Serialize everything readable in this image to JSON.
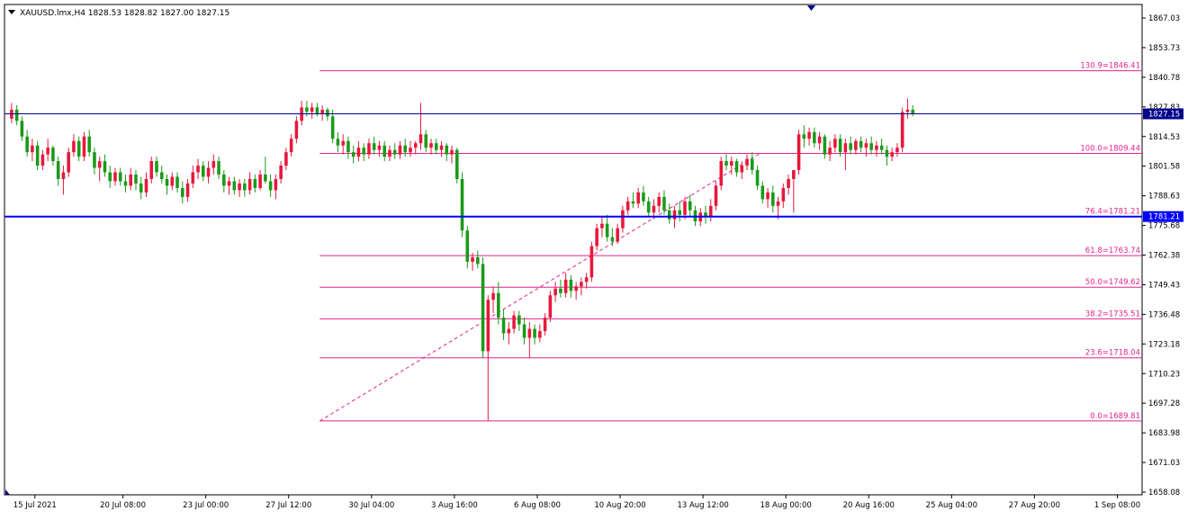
{
  "chart_data": {
    "type": "candlestick",
    "header": {
      "symbol": "XAUUSD.lmx,H4",
      "ohlc": "1828.53 1828.82 1827.00 1827.15"
    },
    "y_range": [
      1658.0,
      1870.0
    ],
    "x_slots": 216,
    "y_ticks": [
      "1867.03",
      "1853.73",
      "1840.78",
      "1827.83",
      "1814.53",
      "1801.58",
      "1788.63",
      "1775.68",
      "1762.38",
      "1749.43",
      "1736.48",
      "1723.18",
      "1710.23",
      "1697.28",
      "1683.98",
      "1671.03",
      "1658.08"
    ],
    "x_ticks": [
      {
        "label": "15 Jul 2021",
        "slot": 5
      },
      {
        "label": "20 Jul 08:00",
        "slot": 22
      },
      {
        "label": "23 Jul 00:00",
        "slot": 38
      },
      {
        "label": "27 Jul 12:00",
        "slot": 54
      },
      {
        "label": "30 Jul 04:00",
        "slot": 70
      },
      {
        "label": "3 Aug 16:00",
        "slot": 86
      },
      {
        "label": "6 Aug 08:00",
        "slot": 102
      },
      {
        "label": "10 Aug 20:00",
        "slot": 118
      },
      {
        "label": "13 Aug 12:00",
        "slot": 134
      },
      {
        "label": "18 Aug 00:00",
        "slot": 150
      },
      {
        "label": "20 Aug 16:00",
        "slot": 166
      },
      {
        "label": "25 Aug 04:00",
        "slot": 182
      },
      {
        "label": "27 Aug 20:00",
        "slot": 198
      },
      {
        "label": "1 Sep 08:00",
        "slot": 214
      }
    ],
    "price_lines": [
      {
        "value": 1827.15,
        "label": "1827.15",
        "color": "#00008b",
        "thick": false
      },
      {
        "value": 1781.21,
        "label": "1781.21",
        "color": "#0000ff",
        "thick": true
      }
    ],
    "fibonacci": {
      "color": "#e0258c",
      "start_slot": 60,
      "trend_start": {
        "slot": 60,
        "price": 1689.81
      },
      "trend_end": {
        "slot": 145,
        "price": 1809.44
      },
      "levels": [
        {
          "label": "130.9=1846.41",
          "value": 1846.41
        },
        {
          "label": "100.0=1809.44",
          "value": 1809.44
        },
        {
          "label": "76.4=1781.21",
          "value": 1781.21
        },
        {
          "label": "61.8=1763.74",
          "value": 1763.74
        },
        {
          "label": "50.0=1749.62",
          "value": 1749.62
        },
        {
          "label": "38.2=1735.51",
          "value": 1735.51
        },
        {
          "label": "23.6=1718.04",
          "value": 1718.04
        },
        {
          "label": "0.0=1689.81",
          "value": 1689.81
        }
      ]
    },
    "bull_color": "#e8173c",
    "bear_color": "#1a9a1a",
    "candles": [
      {
        "o": 1825,
        "h": 1832,
        "l": 1823,
        "c": 1829
      },
      {
        "o": 1829,
        "h": 1831,
        "l": 1822,
        "c": 1824
      },
      {
        "o": 1824,
        "h": 1826,
        "l": 1815,
        "c": 1817
      },
      {
        "o": 1817,
        "h": 1820,
        "l": 1808,
        "c": 1810
      },
      {
        "o": 1810,
        "h": 1816,
        "l": 1806,
        "c": 1813
      },
      {
        "o": 1813,
        "h": 1815,
        "l": 1802,
        "c": 1804
      },
      {
        "o": 1804,
        "h": 1811,
        "l": 1802,
        "c": 1809
      },
      {
        "o": 1809,
        "h": 1816,
        "l": 1806,
        "c": 1812
      },
      {
        "o": 1812,
        "h": 1813,
        "l": 1804,
        "c": 1806
      },
      {
        "o": 1806,
        "h": 1808,
        "l": 1795,
        "c": 1798
      },
      {
        "o": 1798,
        "h": 1804,
        "l": 1791,
        "c": 1801
      },
      {
        "o": 1801,
        "h": 1812,
        "l": 1799,
        "c": 1810
      },
      {
        "o": 1810,
        "h": 1818,
        "l": 1808,
        "c": 1815
      },
      {
        "o": 1815,
        "h": 1817,
        "l": 1806,
        "c": 1808
      },
      {
        "o": 1808,
        "h": 1819,
        "l": 1806,
        "c": 1817
      },
      {
        "o": 1817,
        "h": 1820,
        "l": 1808,
        "c": 1810
      },
      {
        "o": 1810,
        "h": 1812,
        "l": 1800,
        "c": 1803
      },
      {
        "o": 1803,
        "h": 1808,
        "l": 1797,
        "c": 1806
      },
      {
        "o": 1806,
        "h": 1809,
        "l": 1799,
        "c": 1801
      },
      {
        "o": 1801,
        "h": 1804,
        "l": 1794,
        "c": 1797
      },
      {
        "o": 1797,
        "h": 1803,
        "l": 1795,
        "c": 1801
      },
      {
        "o": 1801,
        "h": 1803,
        "l": 1795,
        "c": 1797
      },
      {
        "o": 1797,
        "h": 1800,
        "l": 1792,
        "c": 1795
      },
      {
        "o": 1795,
        "h": 1803,
        "l": 1793,
        "c": 1800
      },
      {
        "o": 1800,
        "h": 1802,
        "l": 1793,
        "c": 1796
      },
      {
        "o": 1796,
        "h": 1799,
        "l": 1789,
        "c": 1792
      },
      {
        "o": 1792,
        "h": 1801,
        "l": 1790,
        "c": 1798
      },
      {
        "o": 1798,
        "h": 1808,
        "l": 1796,
        "c": 1806
      },
      {
        "o": 1806,
        "h": 1808,
        "l": 1799,
        "c": 1801
      },
      {
        "o": 1801,
        "h": 1804,
        "l": 1796,
        "c": 1798
      },
      {
        "o": 1798,
        "h": 1800,
        "l": 1791,
        "c": 1795
      },
      {
        "o": 1795,
        "h": 1801,
        "l": 1793,
        "c": 1799
      },
      {
        "o": 1799,
        "h": 1801,
        "l": 1792,
        "c": 1794
      },
      {
        "o": 1794,
        "h": 1797,
        "l": 1787,
        "c": 1790
      },
      {
        "o": 1790,
        "h": 1798,
        "l": 1788,
        "c": 1796
      },
      {
        "o": 1796,
        "h": 1804,
        "l": 1794,
        "c": 1801
      },
      {
        "o": 1801,
        "h": 1807,
        "l": 1798,
        "c": 1804
      },
      {
        "o": 1804,
        "h": 1806,
        "l": 1797,
        "c": 1799
      },
      {
        "o": 1799,
        "h": 1806,
        "l": 1796,
        "c": 1803
      },
      {
        "o": 1803,
        "h": 1809,
        "l": 1800,
        "c": 1806
      },
      {
        "o": 1806,
        "h": 1808,
        "l": 1798,
        "c": 1800
      },
      {
        "o": 1800,
        "h": 1802,
        "l": 1792,
        "c": 1795
      },
      {
        "o": 1795,
        "h": 1799,
        "l": 1791,
        "c": 1797
      },
      {
        "o": 1797,
        "h": 1799,
        "l": 1791,
        "c": 1793
      },
      {
        "o": 1793,
        "h": 1798,
        "l": 1790,
        "c": 1796
      },
      {
        "o": 1796,
        "h": 1798,
        "l": 1790,
        "c": 1793
      },
      {
        "o": 1793,
        "h": 1801,
        "l": 1791,
        "c": 1798
      },
      {
        "o": 1798,
        "h": 1800,
        "l": 1792,
        "c": 1794
      },
      {
        "o": 1794,
        "h": 1802,
        "l": 1793,
        "c": 1800
      },
      {
        "o": 1800,
        "h": 1808,
        "l": 1796,
        "c": 1797
      },
      {
        "o": 1797,
        "h": 1800,
        "l": 1790,
        "c": 1793
      },
      {
        "o": 1793,
        "h": 1800,
        "l": 1789,
        "c": 1798
      },
      {
        "o": 1798,
        "h": 1806,
        "l": 1796,
        "c": 1804
      },
      {
        "o": 1804,
        "h": 1812,
        "l": 1802,
        "c": 1810
      },
      {
        "o": 1810,
        "h": 1818,
        "l": 1808,
        "c": 1816
      },
      {
        "o": 1816,
        "h": 1826,
        "l": 1814,
        "c": 1824
      },
      {
        "o": 1824,
        "h": 1833,
        "l": 1822,
        "c": 1830
      },
      {
        "o": 1830,
        "h": 1833,
        "l": 1826,
        "c": 1828
      },
      {
        "o": 1828,
        "h": 1832,
        "l": 1825,
        "c": 1830
      },
      {
        "o": 1830,
        "h": 1832,
        "l": 1826,
        "c": 1827
      },
      {
        "o": 1827,
        "h": 1831,
        "l": 1824,
        "c": 1829
      },
      {
        "o": 1829,
        "h": 1830,
        "l": 1824,
        "c": 1826
      },
      {
        "o": 1826,
        "h": 1829,
        "l": 1814,
        "c": 1816
      },
      {
        "o": 1816,
        "h": 1819,
        "l": 1810,
        "c": 1813
      },
      {
        "o": 1813,
        "h": 1818,
        "l": 1809,
        "c": 1815
      },
      {
        "o": 1815,
        "h": 1817,
        "l": 1807,
        "c": 1810
      },
      {
        "o": 1810,
        "h": 1813,
        "l": 1805,
        "c": 1808
      },
      {
        "o": 1808,
        "h": 1815,
        "l": 1806,
        "c": 1812
      },
      {
        "o": 1812,
        "h": 1814,
        "l": 1806,
        "c": 1809
      },
      {
        "o": 1809,
        "h": 1816,
        "l": 1807,
        "c": 1814
      },
      {
        "o": 1814,
        "h": 1817,
        "l": 1809,
        "c": 1811
      },
      {
        "o": 1811,
        "h": 1815,
        "l": 1808,
        "c": 1813
      },
      {
        "o": 1813,
        "h": 1815,
        "l": 1806,
        "c": 1808
      },
      {
        "o": 1808,
        "h": 1813,
        "l": 1806,
        "c": 1811
      },
      {
        "o": 1811,
        "h": 1814,
        "l": 1807,
        "c": 1809
      },
      {
        "o": 1809,
        "h": 1815,
        "l": 1807,
        "c": 1813
      },
      {
        "o": 1813,
        "h": 1816,
        "l": 1808,
        "c": 1810
      },
      {
        "o": 1810,
        "h": 1815,
        "l": 1808,
        "c": 1812
      },
      {
        "o": 1812,
        "h": 1815,
        "l": 1809,
        "c": 1814
      },
      {
        "o": 1814,
        "h": 1832,
        "l": 1811,
        "c": 1818
      },
      {
        "o": 1818,
        "h": 1820,
        "l": 1810,
        "c": 1812
      },
      {
        "o": 1812,
        "h": 1816,
        "l": 1809,
        "c": 1814
      },
      {
        "o": 1814,
        "h": 1816,
        "l": 1809,
        "c": 1811
      },
      {
        "o": 1811,
        "h": 1815,
        "l": 1808,
        "c": 1813
      },
      {
        "o": 1813,
        "h": 1814,
        "l": 1806,
        "c": 1809
      },
      {
        "o": 1809,
        "h": 1813,
        "l": 1805,
        "c": 1811
      },
      {
        "o": 1811,
        "h": 1812,
        "l": 1796,
        "c": 1798
      },
      {
        "o": 1798,
        "h": 1801,
        "l": 1772,
        "c": 1775
      },
      {
        "o": 1775,
        "h": 1777,
        "l": 1758,
        "c": 1761
      },
      {
        "o": 1761,
        "h": 1765,
        "l": 1757,
        "c": 1763
      },
      {
        "o": 1763,
        "h": 1766,
        "l": 1758,
        "c": 1760
      },
      {
        "o": 1760,
        "h": 1763,
        "l": 1718,
        "c": 1721
      },
      {
        "o": 1721,
        "h": 1746,
        "l": 1689.81,
        "c": 1744
      },
      {
        "o": 1744,
        "h": 1750,
        "l": 1738,
        "c": 1747
      },
      {
        "o": 1747,
        "h": 1752,
        "l": 1733,
        "c": 1736
      },
      {
        "o": 1736,
        "h": 1740,
        "l": 1726,
        "c": 1729
      },
      {
        "o": 1729,
        "h": 1734,
        "l": 1724,
        "c": 1731
      },
      {
        "o": 1731,
        "h": 1739,
        "l": 1729,
        "c": 1737
      },
      {
        "o": 1737,
        "h": 1739,
        "l": 1730,
        "c": 1733
      },
      {
        "o": 1733,
        "h": 1736,
        "l": 1724,
        "c": 1727
      },
      {
        "o": 1727,
        "h": 1734,
        "l": 1718,
        "c": 1731
      },
      {
        "o": 1731,
        "h": 1733,
        "l": 1724,
        "c": 1727
      },
      {
        "o": 1727,
        "h": 1733,
        "l": 1725,
        "c": 1730
      },
      {
        "o": 1730,
        "h": 1738,
        "l": 1728,
        "c": 1736
      },
      {
        "o": 1736,
        "h": 1748,
        "l": 1734,
        "c": 1746
      },
      {
        "o": 1746,
        "h": 1752,
        "l": 1743,
        "c": 1749
      },
      {
        "o": 1749,
        "h": 1753,
        "l": 1745,
        "c": 1747
      },
      {
        "o": 1747,
        "h": 1756,
        "l": 1745,
        "c": 1753
      },
      {
        "o": 1753,
        "h": 1755,
        "l": 1745,
        "c": 1748
      },
      {
        "o": 1748,
        "h": 1752,
        "l": 1744,
        "c": 1750
      },
      {
        "o": 1750,
        "h": 1754,
        "l": 1746,
        "c": 1752
      },
      {
        "o": 1752,
        "h": 1756,
        "l": 1749,
        "c": 1754
      },
      {
        "o": 1754,
        "h": 1770,
        "l": 1752,
        "c": 1768
      },
      {
        "o": 1768,
        "h": 1778,
        "l": 1766,
        "c": 1776
      },
      {
        "o": 1776,
        "h": 1781,
        "l": 1772,
        "c": 1778
      },
      {
        "o": 1778,
        "h": 1782,
        "l": 1770,
        "c": 1772
      },
      {
        "o": 1772,
        "h": 1776,
        "l": 1768,
        "c": 1770
      },
      {
        "o": 1770,
        "h": 1778,
        "l": 1769,
        "c": 1776
      },
      {
        "o": 1776,
        "h": 1786,
        "l": 1774,
        "c": 1784
      },
      {
        "o": 1784,
        "h": 1790,
        "l": 1782,
        "c": 1788
      },
      {
        "o": 1788,
        "h": 1792,
        "l": 1785,
        "c": 1787
      },
      {
        "o": 1787,
        "h": 1794,
        "l": 1785,
        "c": 1792
      },
      {
        "o": 1792,
        "h": 1795,
        "l": 1786,
        "c": 1788
      },
      {
        "o": 1788,
        "h": 1790,
        "l": 1781,
        "c": 1783
      },
      {
        "o": 1783,
        "h": 1789,
        "l": 1780,
        "c": 1786
      },
      {
        "o": 1786,
        "h": 1792,
        "l": 1783,
        "c": 1790
      },
      {
        "o": 1790,
        "h": 1793,
        "l": 1782,
        "c": 1784
      },
      {
        "o": 1784,
        "h": 1787,
        "l": 1778,
        "c": 1780
      },
      {
        "o": 1780,
        "h": 1786,
        "l": 1776,
        "c": 1784
      },
      {
        "o": 1784,
        "h": 1788,
        "l": 1779,
        "c": 1782
      },
      {
        "o": 1782,
        "h": 1790,
        "l": 1780,
        "c": 1788
      },
      {
        "o": 1788,
        "h": 1791,
        "l": 1781,
        "c": 1784
      },
      {
        "o": 1784,
        "h": 1786,
        "l": 1777,
        "c": 1779
      },
      {
        "o": 1779,
        "h": 1785,
        "l": 1777,
        "c": 1783
      },
      {
        "o": 1783,
        "h": 1786,
        "l": 1778,
        "c": 1781
      },
      {
        "o": 1781,
        "h": 1789,
        "l": 1779,
        "c": 1786
      },
      {
        "o": 1786,
        "h": 1797,
        "l": 1784,
        "c": 1795
      },
      {
        "o": 1795,
        "h": 1808,
        "l": 1793,
        "c": 1806
      },
      {
        "o": 1806,
        "h": 1809,
        "l": 1802,
        "c": 1804
      },
      {
        "o": 1804,
        "h": 1808,
        "l": 1800,
        "c": 1806
      },
      {
        "o": 1806,
        "h": 1807,
        "l": 1799,
        "c": 1801
      },
      {
        "o": 1801,
        "h": 1806,
        "l": 1798,
        "c": 1804
      },
      {
        "o": 1804,
        "h": 1809,
        "l": 1802,
        "c": 1807
      },
      {
        "o": 1807,
        "h": 1810,
        "l": 1800,
        "c": 1802
      },
      {
        "o": 1802,
        "h": 1804,
        "l": 1793,
        "c": 1795
      },
      {
        "o": 1795,
        "h": 1797,
        "l": 1787,
        "c": 1789
      },
      {
        "o": 1789,
        "h": 1794,
        "l": 1785,
        "c": 1792
      },
      {
        "o": 1792,
        "h": 1795,
        "l": 1783,
        "c": 1786
      },
      {
        "o": 1786,
        "h": 1790,
        "l": 1780,
        "c": 1788
      },
      {
        "o": 1788,
        "h": 1796,
        "l": 1785,
        "c": 1794
      },
      {
        "o": 1794,
        "h": 1800,
        "l": 1791,
        "c": 1798
      },
      {
        "o": 1798,
        "h": 1802,
        "l": 1783,
        "c": 1802
      },
      {
        "o": 1802,
        "h": 1820,
        "l": 1800,
        "c": 1818
      },
      {
        "o": 1818,
        "h": 1822,
        "l": 1812,
        "c": 1816
      },
      {
        "o": 1816,
        "h": 1821,
        "l": 1813,
        "c": 1819
      },
      {
        "o": 1819,
        "h": 1821,
        "l": 1812,
        "c": 1814
      },
      {
        "o": 1814,
        "h": 1819,
        "l": 1811,
        "c": 1817
      },
      {
        "o": 1817,
        "h": 1818,
        "l": 1807,
        "c": 1809
      },
      {
        "o": 1809,
        "h": 1815,
        "l": 1806,
        "c": 1812
      },
      {
        "o": 1812,
        "h": 1818,
        "l": 1810,
        "c": 1816
      },
      {
        "o": 1816,
        "h": 1818,
        "l": 1808,
        "c": 1810
      },
      {
        "o": 1810,
        "h": 1816,
        "l": 1802,
        "c": 1814
      },
      {
        "o": 1814,
        "h": 1817,
        "l": 1809,
        "c": 1811
      },
      {
        "o": 1811,
        "h": 1816,
        "l": 1809,
        "c": 1815
      },
      {
        "o": 1815,
        "h": 1817,
        "l": 1810,
        "c": 1812
      },
      {
        "o": 1812,
        "h": 1816,
        "l": 1808,
        "c": 1814
      },
      {
        "o": 1814,
        "h": 1817,
        "l": 1809,
        "c": 1811
      },
      {
        "o": 1811,
        "h": 1815,
        "l": 1808,
        "c": 1813
      },
      {
        "o": 1813,
        "h": 1816,
        "l": 1809,
        "c": 1811
      },
      {
        "o": 1811,
        "h": 1813,
        "l": 1804,
        "c": 1808
      },
      {
        "o": 1808,
        "h": 1812,
        "l": 1806,
        "c": 1810
      },
      {
        "o": 1810,
        "h": 1814,
        "l": 1808,
        "c": 1812
      },
      {
        "o": 1812,
        "h": 1830,
        "l": 1810,
        "c": 1828
      },
      {
        "o": 1828,
        "h": 1834,
        "l": 1825,
        "c": 1829
      },
      {
        "o": 1829,
        "h": 1831,
        "l": 1826,
        "c": 1827.15
      }
    ]
  }
}
